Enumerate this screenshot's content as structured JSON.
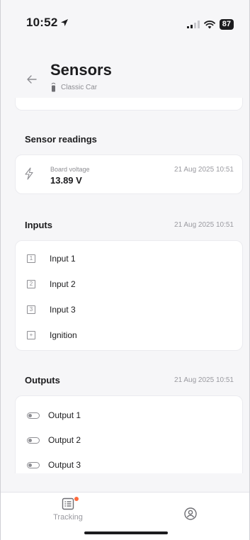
{
  "status_bar": {
    "time": "10:52",
    "battery": "87"
  },
  "header": {
    "title": "Sensors",
    "subtitle": "Classic Car"
  },
  "sensor_readings": {
    "title": "Sensor readings",
    "items": [
      {
        "label": "Board voltage",
        "value": "13.89 V",
        "timestamp": "21 Aug 2025 10:51",
        "icon": "lightning-icon"
      }
    ]
  },
  "inputs": {
    "title": "Inputs",
    "timestamp": "21 Aug 2025 10:51",
    "items": [
      {
        "label": "Input 1",
        "icon_glyph": "1"
      },
      {
        "label": "Input 2",
        "icon_glyph": "2"
      },
      {
        "label": "Input 3",
        "icon_glyph": "3"
      },
      {
        "label": "Ignition",
        "icon_glyph": "+"
      }
    ]
  },
  "outputs": {
    "title": "Outputs",
    "timestamp": "21 Aug 2025 10:51",
    "items": [
      {
        "label": "Output 1",
        "state": "off"
      },
      {
        "label": "Output 2",
        "state": "off"
      },
      {
        "label": "Output 3",
        "state": "off"
      }
    ]
  },
  "tab_bar": {
    "tabs": [
      {
        "label": "Tracking",
        "icon": "tracking-list-icon",
        "has_badge": true
      },
      {
        "label": "",
        "icon": "profile-icon",
        "has_badge": false
      }
    ]
  },
  "colors": {
    "background": "#f6f6f8",
    "card": "#ffffff",
    "text_primary": "#1c1c1e",
    "text_secondary": "#8e8e93",
    "badge": "#ff6a3d"
  }
}
